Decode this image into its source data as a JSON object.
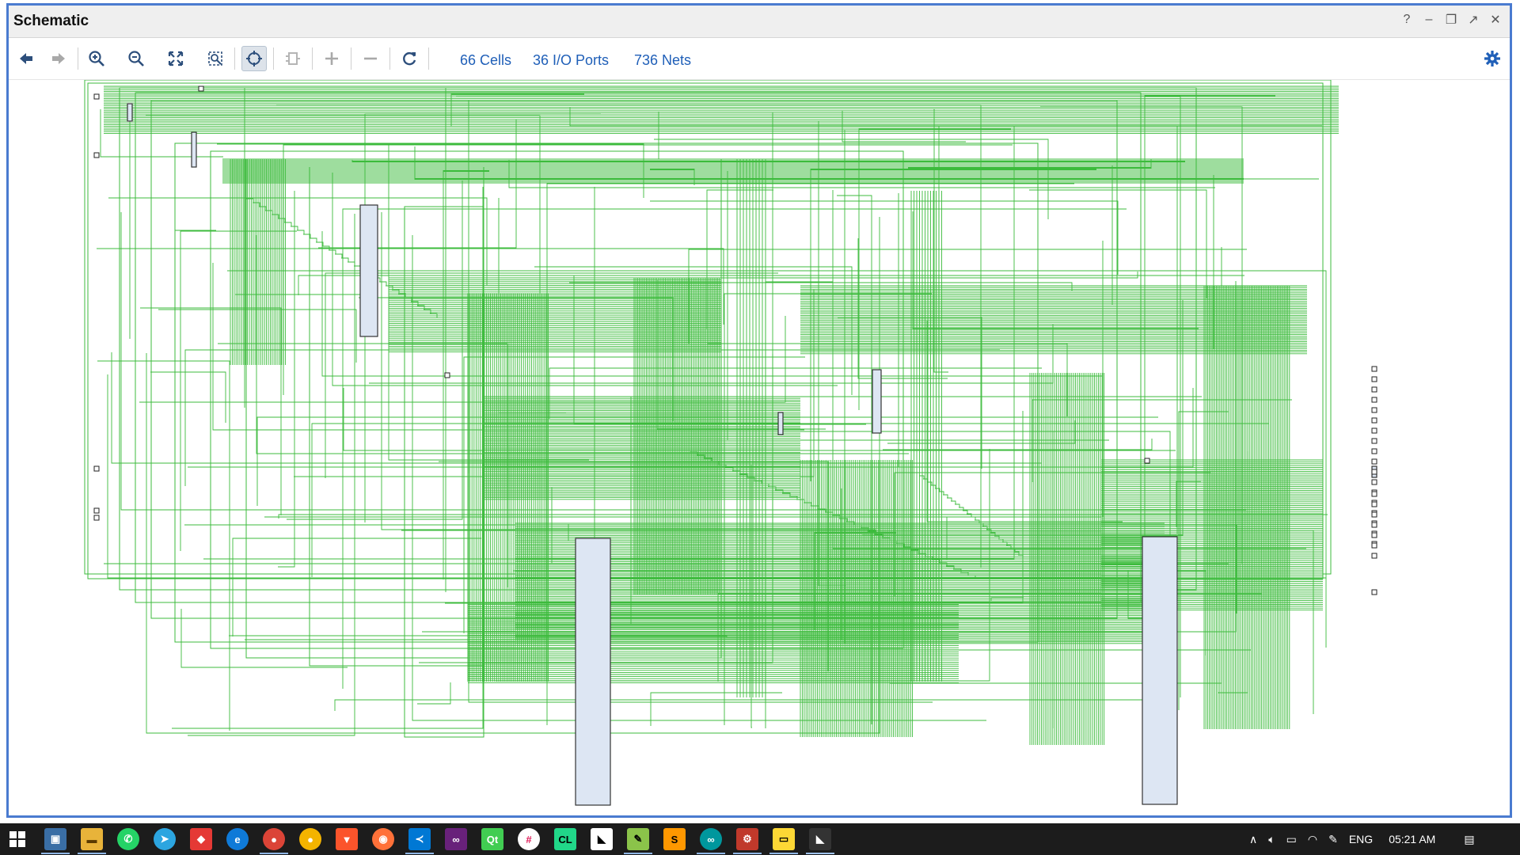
{
  "window": {
    "title": "Schematic",
    "controls": {
      "help": "?",
      "minimize": "–",
      "restore": "❐",
      "maximize": "↗",
      "close": "✕"
    }
  },
  "toolbar": {
    "buttons": [
      "back-arrow",
      "forward-arrow",
      "zoom-in",
      "zoom-out",
      "zoom-fit",
      "zoom-area",
      "select-target",
      "expand-cell",
      "add",
      "remove",
      "refresh"
    ],
    "stats": {
      "cells": "66 Cells",
      "ports": "36 I/O Ports",
      "nets": "736 Nets"
    },
    "settings_icon": "gear-icon"
  },
  "schematic": {
    "net_color": "#3cbb3c",
    "cell_fill": "#dde6f3",
    "cell_stroke": "#333333",
    "cell_count": 66,
    "io_port_count": 36,
    "net_count": 736
  },
  "taskbar": {
    "apps": [
      "windows-start",
      "photos",
      "file-explorer",
      "whatsapp",
      "telegram",
      "anydesk",
      "edge",
      "chrome",
      "chrome-alt",
      "brave",
      "firefox",
      "vscode",
      "visual-studio",
      "qt-creator",
      "slack",
      "clion",
      "vivado",
      "notepad-plus",
      "sublime-text",
      "arduino",
      "tool",
      "folder-app",
      "vivado-active"
    ],
    "tray": {
      "language": "ENG",
      "time": "05:21 AM"
    }
  }
}
